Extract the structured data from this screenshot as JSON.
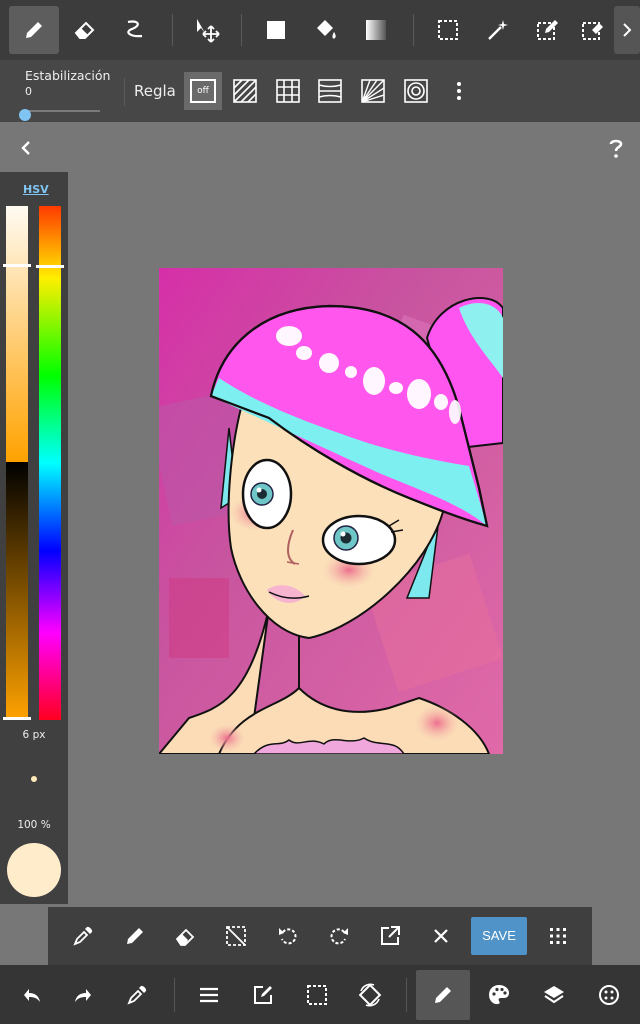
{
  "subbar": {
    "stabilization_label": "Estabilización",
    "stabilization_value": "0",
    "ruler_label": "Regla",
    "ruler_off": "off"
  },
  "left_panel": {
    "color_mode": "HSV",
    "brush_size": "6 px",
    "opacity": "100 %",
    "current_color": "#ffeccb"
  },
  "toolrow": {
    "save_label": "SAVE"
  },
  "colors": {
    "accent": "#4f93c8",
    "toolbar": "#3c3c3c",
    "canvas_bg": "#777777"
  }
}
